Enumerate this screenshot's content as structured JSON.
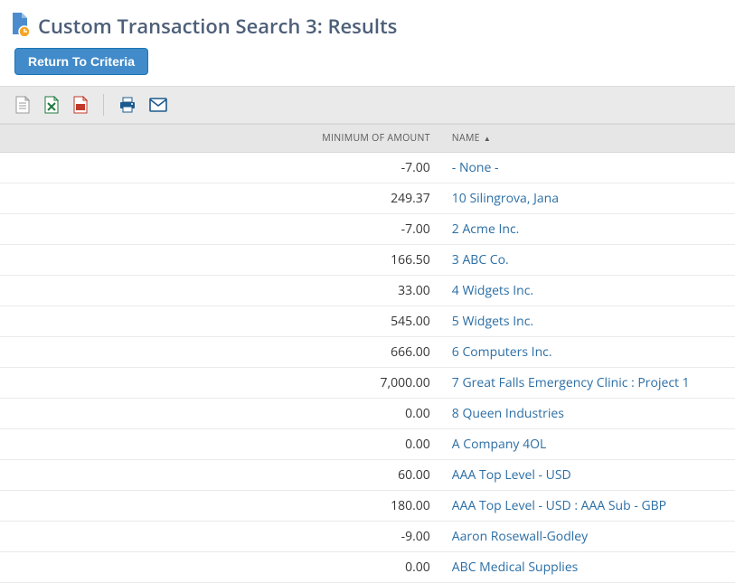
{
  "header": {
    "title": "Custom Transaction Search 3: Results"
  },
  "buttons": {
    "return": "Return To Criteria"
  },
  "columns": {
    "amount": "MINIMUM OF AMOUNT",
    "name": "NAME"
  },
  "rows": [
    {
      "amount": "-7.00",
      "name": "- None -"
    },
    {
      "amount": "249.37",
      "name": "10 Silingrova, Jana"
    },
    {
      "amount": "-7.00",
      "name": "2 Acme Inc."
    },
    {
      "amount": "166.50",
      "name": "3 ABC Co."
    },
    {
      "amount": "33.00",
      "name": "4 Widgets Inc."
    },
    {
      "amount": "545.00",
      "name": "5 Widgets Inc."
    },
    {
      "amount": "666.00",
      "name": "6 Computers Inc."
    },
    {
      "amount": "7,000.00",
      "name": "7 Great Falls Emergency Clinic : Project 1"
    },
    {
      "amount": "0.00",
      "name": "8 Queen Industries"
    },
    {
      "amount": "0.00",
      "name": "A Company 4OL"
    },
    {
      "amount": "60.00",
      "name": "AAA Top Level - USD"
    },
    {
      "amount": "180.00",
      "name": "AAA Top Level - USD : AAA Sub - GBP"
    },
    {
      "amount": "-9.00",
      "name": "Aaron Rosewall-Godley"
    },
    {
      "amount": "0.00",
      "name": "ABC Medical Supplies"
    }
  ]
}
